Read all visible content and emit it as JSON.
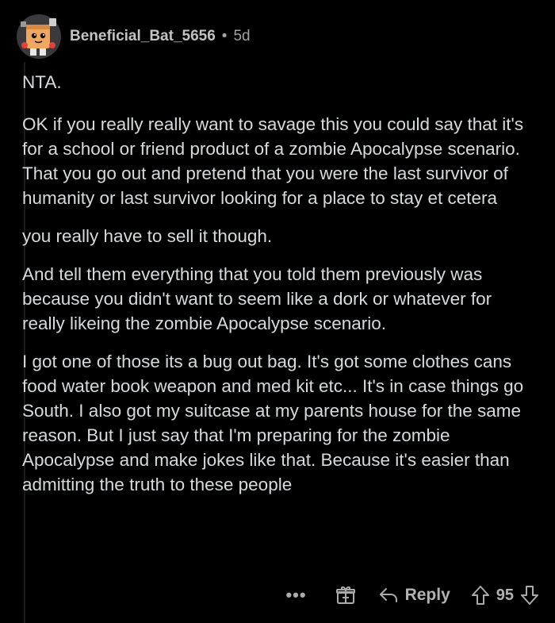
{
  "comment": {
    "author": "Beneficial_Bat_5656",
    "separator": "•",
    "age": "5d",
    "paragraphs": [
      "NTA.",
      "OK if you really really want to savage this you could say that it's for a school or friend product of a zombie Apocalypse scenario. That you go out and pretend that you were the last survivor of humanity or last survivor looking for a place to stay et cetera",
      "you really have to sell it though.",
      "And tell them everything that you told them previously was because you didn't want to seem like a dork or whatever for really likeing the zombie Apocalypse scenario.",
      "I got one of those its a bug out bag.  It's got some clothes cans food water book weapon and med kit etc... It's in case things go South. I also got my suitcase at my parents house for the same reason. But I just say that I'm preparing for the zombie Apocalypse and make jokes like that. Because it's easier than admitting the truth to these people"
    ]
  },
  "actions": {
    "more_label": "•••",
    "reply_label": "Reply",
    "score": "95"
  },
  "icons": {
    "avatar": "snoo-avatar-icon",
    "award": "award-gift-icon",
    "reply": "reply-arrow-icon",
    "upvote": "upvote-arrow-icon",
    "downvote": "downvote-arrow-icon"
  },
  "colors": {
    "background": "#000000",
    "text": "#d7dadc",
    "meta": "#a0a2a4"
  }
}
